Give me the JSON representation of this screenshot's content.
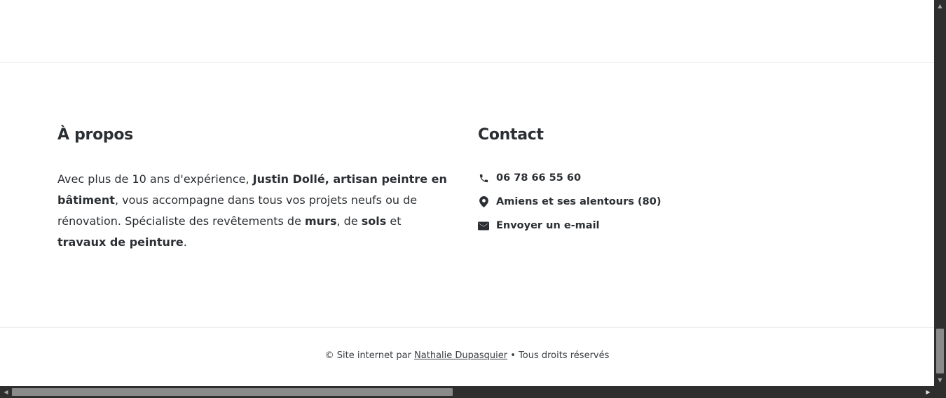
{
  "about": {
    "title": "À propos",
    "text_parts": [
      {
        "t": "Avec plus de 10 ans d'expérience, ",
        "bold": false
      },
      {
        "t": "Justin Dollé, artisan peintre en bâtiment",
        "bold": true
      },
      {
        "t": ", vous accompagne dans tous vos projets neufs ou de rénovation. Spécialiste des revêtements de ",
        "bold": false
      },
      {
        "t": "murs",
        "bold": true
      },
      {
        "t": ", de ",
        "bold": false
      },
      {
        "t": "sols",
        "bold": true
      },
      {
        "t": " et ",
        "bold": false
      },
      {
        "t": "travaux de peinture",
        "bold": true
      },
      {
        "t": ".",
        "bold": false
      }
    ]
  },
  "contact": {
    "title": "Contact",
    "items": [
      {
        "icon": "phone-icon",
        "label": "06 78 66 55 60"
      },
      {
        "icon": "map-pin-icon",
        "label": "Amiens et ses alentours (80)"
      },
      {
        "icon": "envelope-icon",
        "label": "Envoyer un e-mail"
      }
    ]
  },
  "footer": {
    "prefix": "© Site internet par ",
    "author_link": "Nathalie Dupasquier",
    "suffix": " • Tous droits réservés"
  },
  "colors": {
    "text": "#2b2f33",
    "divider": "#ececec",
    "scrollbar_track": "#2e2e2e",
    "scrollbar_thumb": "#8a8a8a"
  }
}
